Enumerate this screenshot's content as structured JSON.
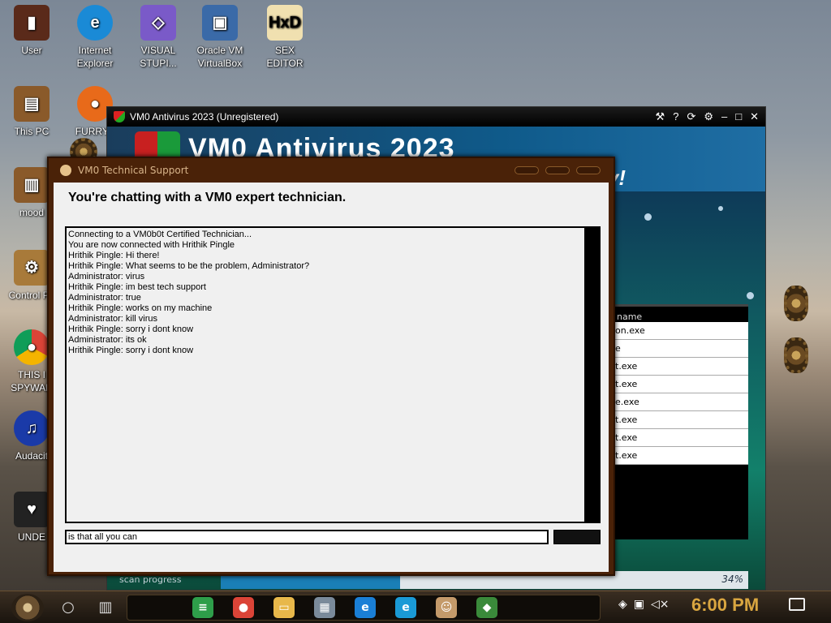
{
  "desktop": {
    "icons": [
      {
        "label": "User"
      },
      {
        "label": "Internet\nExplorer"
      },
      {
        "label": "VISUAL\nSTUPI..."
      },
      {
        "label": "Oracle VM\nVirtualBox"
      },
      {
        "label": "SEX\nEDITOR"
      },
      {
        "label": "This PC"
      },
      {
        "label": "FURRYF"
      },
      {
        "label": "mood"
      },
      {
        "label": "Control Pa"
      },
      {
        "label": "THIS I\nSPYWAR"
      },
      {
        "label": "Audacit"
      },
      {
        "label": "UNDE"
      }
    ]
  },
  "antivirus": {
    "title": "VM0 Antivirus 2023 (Unregistered)",
    "banner_title": "VM0 Antivirus 2023",
    "banner_subtitle": "ity!",
    "process_header": "name",
    "processes": [
      "on.exe",
      "e",
      "t.exe",
      "t.exe",
      "e.exe",
      "t.exe",
      "t.exe",
      "t.exe"
    ],
    "progress_label": "scan progress",
    "progress_percent": 34,
    "progress_text": "34%"
  },
  "support": {
    "title": "VM0 Technical Support",
    "heading": "You're chatting with a VM0 expert technician.",
    "messages": [
      "Connecting to a VM0b0t Certified Technician...",
      "You are now connected with Hrithik Pingle",
      "Hrithik Pingle: Hi there!",
      "Hrithik Pingle: What seems to be the problem, Administrator?",
      "Administrator: virus",
      "Hrithik Pingle: im best tech support",
      "Administrator: true",
      "Hrithik Pingle: works on my machine",
      "Administrator: kill virus",
      "Hrithik Pingle: sorry i dont know",
      "Administrator: its ok",
      "Hrithik Pingle: sorry i dont know"
    ],
    "input_value": "is that all you can"
  },
  "taskbar": {
    "clock": "6:00 PM",
    "apps": [
      {
        "name": "spreadsheet-app-icon",
        "color": "#2e9e4a",
        "glyph": "≡"
      },
      {
        "name": "chrome-icon",
        "color": "#db4437",
        "glyph": "●"
      },
      {
        "name": "file-explorer-icon",
        "color": "#e8b84a",
        "glyph": "▭"
      },
      {
        "name": "photos-icon",
        "color": "#7a8a9a",
        "glyph": "▦"
      },
      {
        "name": "internet-explorer-icon",
        "color": "#1a7fd6",
        "glyph": "e"
      },
      {
        "name": "edge-icon",
        "color": "#1a9ad6",
        "glyph": "e"
      },
      {
        "name": "tech-support-icon",
        "color": "#c49a6a",
        "glyph": "☺"
      },
      {
        "name": "antivirus-shield-icon",
        "color": "#3a8a3a",
        "glyph": "◆"
      }
    ]
  }
}
